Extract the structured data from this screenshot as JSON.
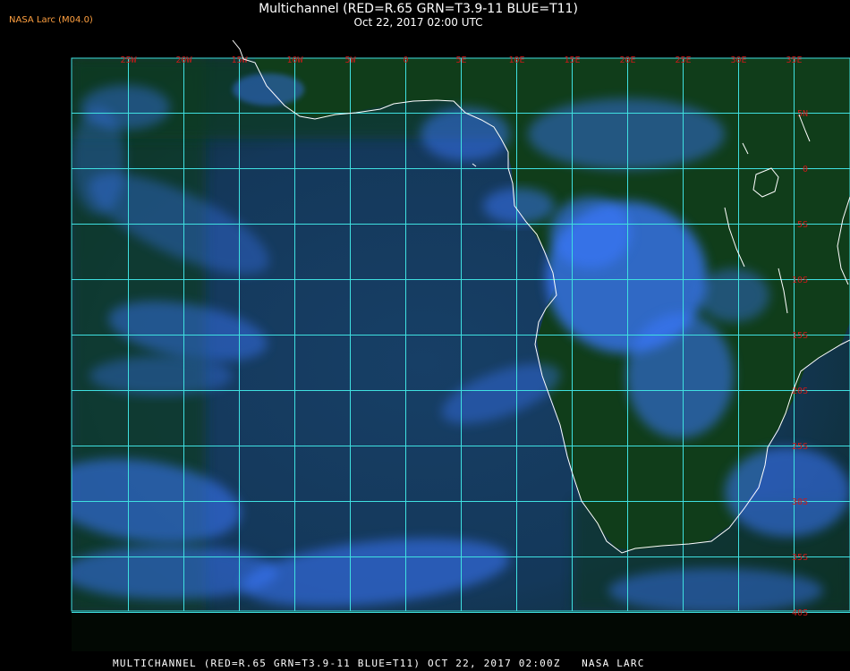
{
  "header": {
    "credit": "NASA Larc (M04.0)",
    "title": "Multichannel (RED=R.65 GRN=T3.9-11 BLUE=T11)",
    "subtitle": "Oct 22, 2017 02:00 UTC"
  },
  "footer": {
    "caption": "MULTICHANNEL (RED=R.65 GRN=T3.9-11 BLUE=T11) OCT 22, 2017 02:00Z   NASA LARC"
  },
  "map": {
    "longitude_labels": [
      "25W",
      "20W",
      "15W",
      "10W",
      "5W",
      "0",
      "5E",
      "10E",
      "15E",
      "20E",
      "25E",
      "30E",
      "35E"
    ],
    "latitude_labels": [
      "5N",
      "0",
      "5S",
      "10S",
      "15S",
      "20S",
      "25S",
      "30S",
      "35S",
      "40S"
    ],
    "colors": {
      "gridline": "#3fe0e0",
      "coastline": "#ffffff",
      "label": "#d01818",
      "ocean": "#163a5a",
      "land": "#0f3a18",
      "cloud": "#3a78ff"
    }
  }
}
